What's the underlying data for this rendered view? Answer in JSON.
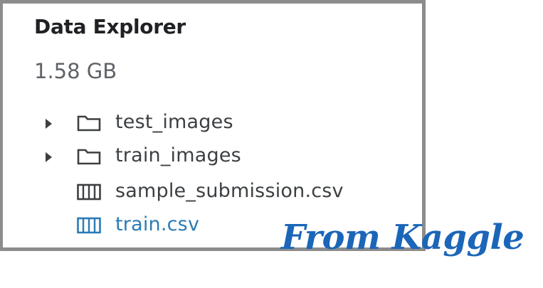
{
  "panel": {
    "title": "Data Explorer",
    "total_size": "1.58 GB"
  },
  "tree": {
    "items": [
      {
        "label": "test_images",
        "type": "folder",
        "expandable": true
      },
      {
        "label": "train_images",
        "type": "folder",
        "expandable": true
      },
      {
        "label": "sample_submission.csv",
        "type": "table",
        "expandable": false
      },
      {
        "label": "train.csv",
        "type": "table",
        "expandable": false,
        "selected": true
      }
    ]
  },
  "icons": {
    "expand": "caret-right-icon",
    "folder": "folder-icon",
    "table": "table-icon"
  },
  "colors": {
    "text": "#3c4043",
    "selected": "#2a7bb6",
    "border": "#8c8c8c",
    "watermark": "#1b66b8"
  },
  "watermark": {
    "text": "From Kaggle"
  }
}
